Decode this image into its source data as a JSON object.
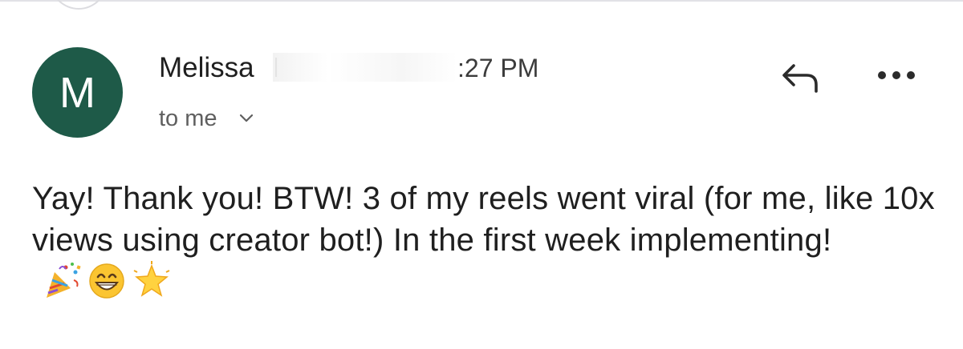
{
  "message": {
    "avatar_letter": "M",
    "sender_name": "Melissa",
    "time": ":27 PM",
    "recipient_label": "to me",
    "body_text": "Yay! Thank you! BTW! 3 of my reels went viral (for me, like 10x views using creator bot!) In the first week implementing!",
    "emojis": [
      "party-popper-icon",
      "grinning-face-icon",
      "glowing-star-icon"
    ]
  },
  "colors": {
    "avatar_bg": "#1e5a48",
    "text": "#1f1f1f",
    "muted_text": "#5f5f5f"
  }
}
